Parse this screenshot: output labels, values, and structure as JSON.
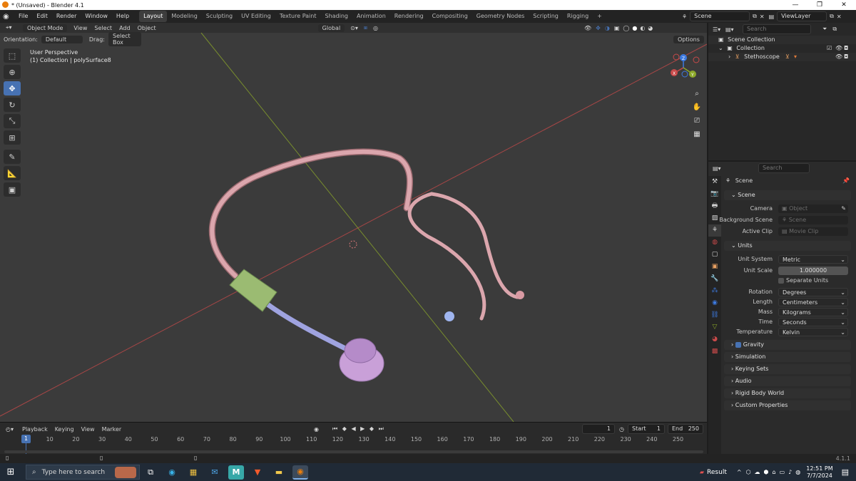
{
  "window": {
    "title": "* (Unsaved) - Blender 4.1",
    "minimize": "—",
    "maximize": "❐",
    "close": "✕"
  },
  "menu": {
    "items": [
      "File",
      "Edit",
      "Render",
      "Window",
      "Help"
    ]
  },
  "workspaces": {
    "tabs": [
      "Layout",
      "Modeling",
      "Sculpting",
      "UV Editing",
      "Texture Paint",
      "Shading",
      "Animation",
      "Rendering",
      "Compositing",
      "Geometry Nodes",
      "Scripting",
      "Rigging"
    ],
    "active": "Layout",
    "add": "+"
  },
  "scene_selector": {
    "scene": "Scene",
    "view_layer": "ViewLayer"
  },
  "viewport_header": {
    "mode": "Object Mode",
    "menus": [
      "View",
      "Select",
      "Add",
      "Object"
    ],
    "transform": "Global",
    "orientation_label": "Orientation:",
    "orientation_value": "Default",
    "drag_label": "Drag:",
    "drag_value": "Select Box",
    "options": "Options"
  },
  "viewport_info": {
    "line1": "User Perspective",
    "line2": "(1) Collection | polySurface8"
  },
  "gizmo": {
    "x": "X",
    "y": "Y",
    "z": "Z"
  },
  "timeline": {
    "menus": [
      "Playback",
      "Keying",
      "View",
      "Marker"
    ],
    "current_frame": "1",
    "start_label": "Start",
    "start": "1",
    "end_label": "End",
    "end": "250",
    "ticks": [
      "10",
      "20",
      "30",
      "40",
      "50",
      "60",
      "70",
      "80",
      "90",
      "100",
      "110",
      "120",
      "130",
      "140",
      "150",
      "160",
      "170",
      "180",
      "190",
      "200",
      "210",
      "220",
      "230",
      "240",
      "250"
    ],
    "cursor": "1"
  },
  "outliner": {
    "search_placeholder": "Search",
    "rows": [
      {
        "label": "Scene Collection"
      },
      {
        "label": "Collection"
      },
      {
        "label": "Stethoscope"
      }
    ]
  },
  "properties": {
    "search_placeholder": "Search",
    "context": "Scene",
    "scene_section": "Scene",
    "camera_label": "Camera",
    "camera_placeholder": "Object",
    "bg_label": "Background Scene",
    "bg_placeholder": "Scene",
    "clip_label": "Active Clip",
    "clip_placeholder": "Movie Clip",
    "units_section": "Units",
    "unit_system_label": "Unit System",
    "unit_system": "Metric",
    "unit_scale_label": "Unit Scale",
    "unit_scale": "1.000000",
    "separate_units": "Separate Units",
    "rotation_label": "Rotation",
    "rotation": "Degrees",
    "length_label": "Length",
    "length": "Centimeters",
    "mass_label": "Mass",
    "mass": "Kilograms",
    "time_label": "Time",
    "time": "Seconds",
    "temp_label": "Temperature",
    "temperature": "Kelvin",
    "collapsed": [
      "Gravity",
      "Simulation",
      "Keying Sets",
      "Audio",
      "Rigid Body World",
      "Custom Properties"
    ]
  },
  "status": {
    "version": "4.1.1"
  },
  "taskbar": {
    "search_placeholder": "Type here to search",
    "weather": "Result",
    "time": "12:51 PM",
    "date": "7/7/2024"
  },
  "colors": {
    "accent": "#4772b3",
    "viewport": "#3b3b3b",
    "x_axis": "#c94a4a",
    "y_axis": "#8ca82a",
    "z_axis": "#3d7ae0"
  }
}
